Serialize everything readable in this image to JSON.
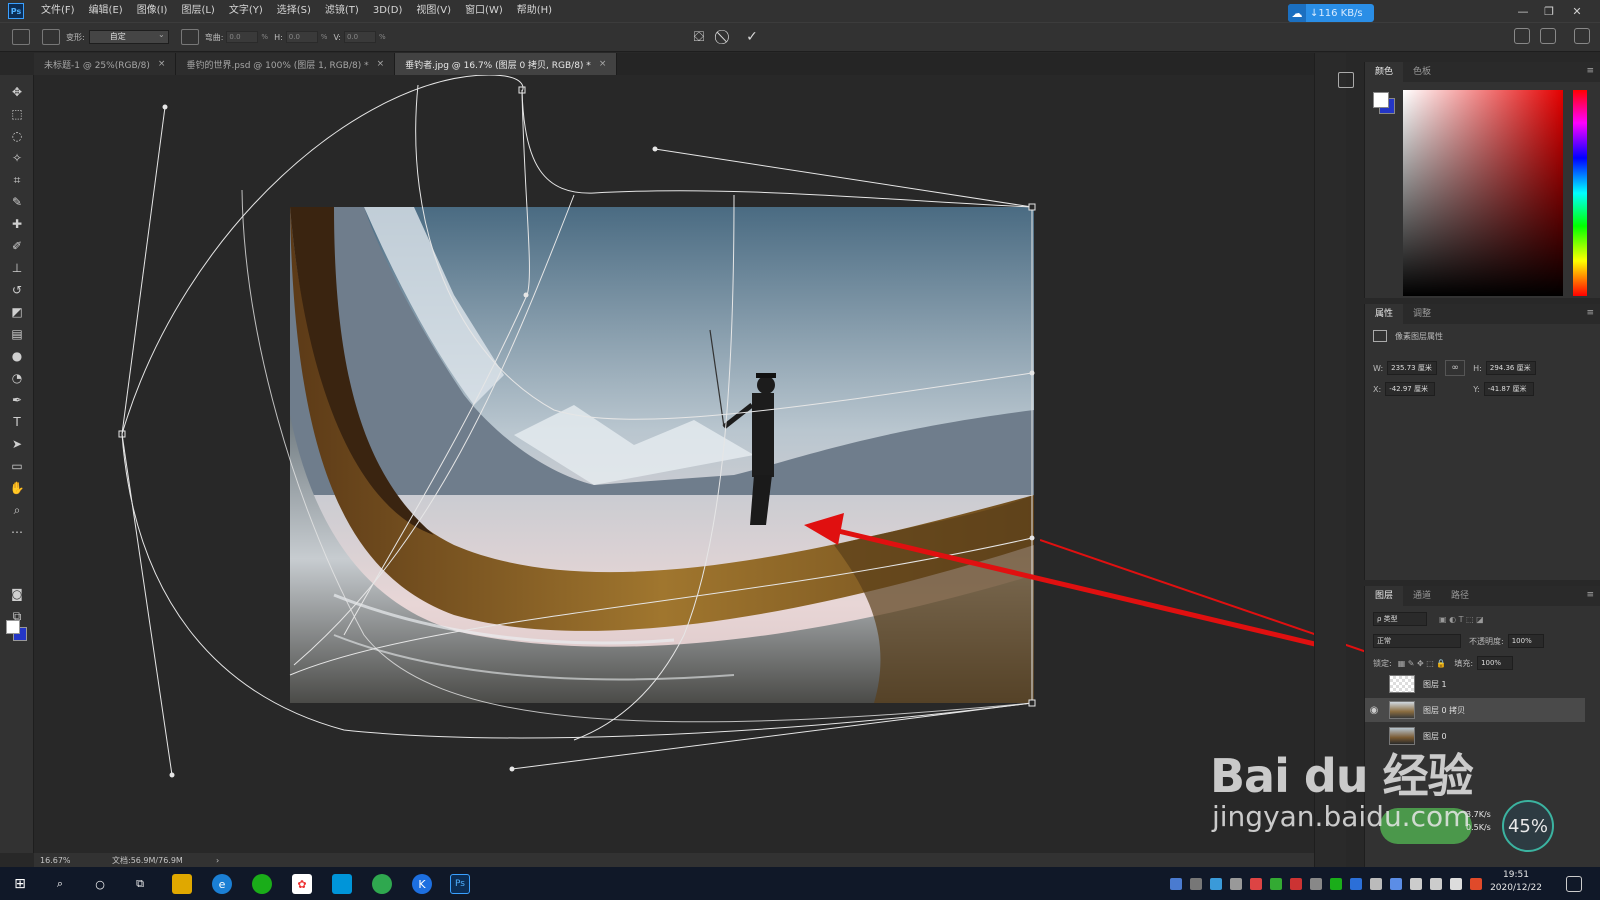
{
  "menu": [
    "文件(F)",
    "编辑(E)",
    "图像(I)",
    "图层(L)",
    "文字(Y)",
    "选择(S)",
    "滤镜(T)",
    "3D(D)",
    "视图(V)",
    "窗口(W)",
    "帮助(H)"
  ],
  "net_speed": "↓116 KB/s",
  "options": {
    "warp_label": "变形:",
    "warp_value": "自定",
    "w_label": "弯曲:",
    "w_value": "0.0",
    "h_label": "H:",
    "h_value": "0.0",
    "v_label": "V:",
    "v_value": "0.0",
    "percent": "%"
  },
  "tabs": [
    {
      "label": "未标题-1 @ 25%(RGB/8)",
      "close": "×"
    },
    {
      "label": "垂钓的世界.psd @ 100% (图层 1, RGB/8) *",
      "close": "×"
    },
    {
      "label": "垂钓者.jpg @ 16.7% (图层 0 拷贝, RGB/8) *",
      "close": "×"
    }
  ],
  "status": {
    "zoom": "16.67%",
    "doc": "文档:56.9M/76.9M",
    "arrow": "›"
  },
  "color_panel": {
    "tab1": "颜色",
    "tab2": "色板",
    "menu": "≡"
  },
  "props_panel": {
    "tab1": "属性",
    "tab2": "调整",
    "menu": "≡",
    "title": "像素图层属性",
    "w_label": "W:",
    "w_value": "235.73 厘米",
    "h_label": "H:",
    "h_value": "294.36 厘米",
    "x_label": "X:",
    "x_value": "-42.97 厘米",
    "y_label": "Y:",
    "y_value": "-41.87 厘米",
    "link": "∞"
  },
  "layers_panel": {
    "tab1": "图层",
    "tab2": "通道",
    "tab3": "路径",
    "menu": "≡",
    "filter_placeholder": "ρ 类型",
    "blend": "正常",
    "opacity_label": "不透明度:",
    "opacity_value": "100%",
    "lock_label": "锁定:",
    "fill_label": "填充:",
    "fill_value": "100%",
    "layers": [
      {
        "name": "图层 1",
        "visible": false
      },
      {
        "name": "图层 0 拷贝",
        "visible": true
      },
      {
        "name": "图层 0",
        "visible": false
      }
    ]
  },
  "watermark": {
    "big": "Bai du 经验",
    "small": "jingyan.baidu.com"
  },
  "speed": {
    "percent": "45%",
    "up": "3.7K/s",
    "down": "0.5K/s"
  },
  "clock": {
    "time": "19:51",
    "date": "2020/12/22"
  },
  "colors": {
    "fg": "#ffffff",
    "bg": "#2436c6",
    "accent": "#2a8ee6",
    "arrow": "#e01010"
  }
}
